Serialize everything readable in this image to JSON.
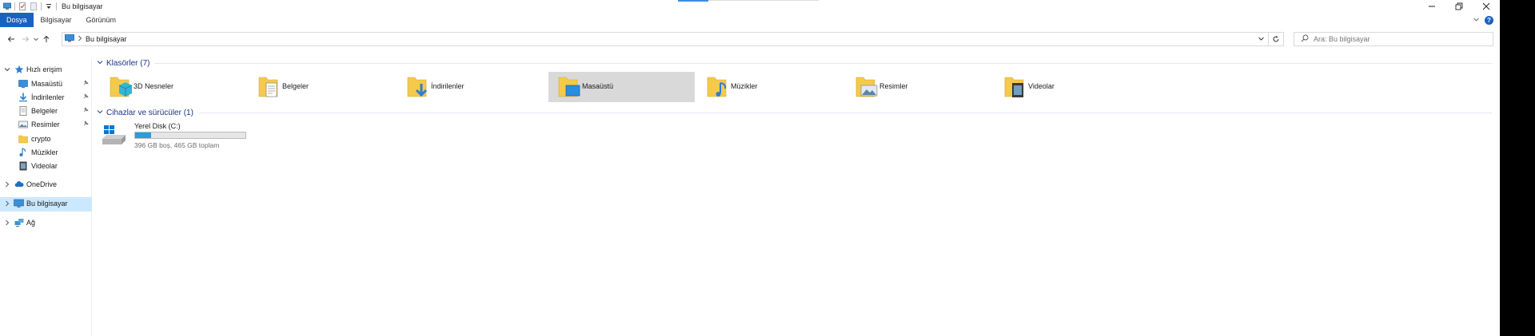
{
  "window": {
    "title": "Bu bilgisayar"
  },
  "ribbon": {
    "tabs": [
      {
        "label": "Dosya"
      },
      {
        "label": "Bilgisayar"
      },
      {
        "label": "Görünüm"
      }
    ]
  },
  "address": {
    "path": "Bu bilgisayar",
    "search_placeholder": "Ara: Bu bilgisayar"
  },
  "nav": {
    "quick_access": "Hızlı erişim",
    "quick_items": [
      {
        "label": "Masaüstü",
        "icon": "desktop-icon",
        "pinned": true
      },
      {
        "label": "İndirilenler",
        "icon": "download-icon",
        "pinned": true
      },
      {
        "label": "Belgeler",
        "icon": "documents-icon",
        "pinned": true
      },
      {
        "label": "Resimler",
        "icon": "pictures-icon",
        "pinned": true
      },
      {
        "label": "crypto",
        "icon": "folder-icon",
        "pinned": false
      },
      {
        "label": "Müzikler",
        "icon": "music-icon",
        "pinned": false
      },
      {
        "label": "Videolar",
        "icon": "videos-icon",
        "pinned": false
      }
    ],
    "onedrive": "OneDrive",
    "this_pc": "Bu bilgisayar",
    "network": "Ağ"
  },
  "content": {
    "folders_header": "Klasörler (7)",
    "folders": [
      {
        "label": "3D Nesneler",
        "icon": "3d-objects-icon"
      },
      {
        "label": "Belgeler",
        "icon": "documents-icon"
      },
      {
        "label": "İndirilenler",
        "icon": "download-icon"
      },
      {
        "label": "Masaüstü",
        "icon": "desktop-icon",
        "selected": true
      },
      {
        "label": "Müzikler",
        "icon": "music-icon"
      },
      {
        "label": "Resimler",
        "icon": "pictures-icon"
      },
      {
        "label": "Videolar",
        "icon": "videos-icon"
      }
    ],
    "drives_header": "Cihazlar ve sürücüler (1)",
    "drives": [
      {
        "name": "Yerel Disk (C:)",
        "free_text": "396 GB boş, 465 GB toplam",
        "used_fraction": 0.148
      }
    ]
  },
  "colors": {
    "accent": "#1a62bf",
    "selection": "#cce8ff",
    "folder_selected": "#d9d9d9",
    "group_header": "#1e3287",
    "drive_fill": "#26a0da"
  }
}
